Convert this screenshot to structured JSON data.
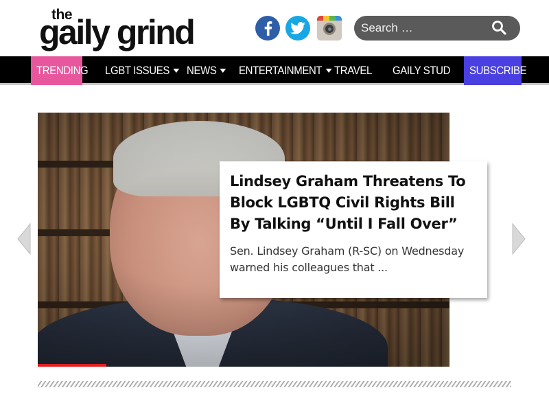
{
  "site": {
    "logo_top": "the",
    "logo_main": "gaily grind"
  },
  "social": [
    {
      "name": "facebook",
      "icon": "facebook-icon",
      "color": "#2f5ea8"
    },
    {
      "name": "twitter",
      "icon": "twitter-icon",
      "color": "#16a7e4"
    },
    {
      "name": "instagram",
      "icon": "instagram-icon",
      "color": "#cfc9bf"
    }
  ],
  "search": {
    "placeholder": "Search …",
    "icon": "search-icon"
  },
  "nav": {
    "items": [
      {
        "label": "TRENDING",
        "dropdown": false
      },
      {
        "label": "LGBT ISSUES",
        "dropdown": true
      },
      {
        "label": "NEWS",
        "dropdown": true
      },
      {
        "label": "ENTERTAINMENT",
        "dropdown": true
      },
      {
        "label": "TRAVEL",
        "dropdown": false
      },
      {
        "label": "GAILY STUD",
        "dropdown": false
      },
      {
        "label": "SUBSCRIBE",
        "dropdown": false
      }
    ],
    "trending_color": "#e8579e",
    "subscribe_color": "#4a3fe0"
  },
  "slider": {
    "title": "Lindsey Graham Threatens To Block LGBTQ Civil Rights Bill By Talking “Until I Fall Over”",
    "excerpt": "Sen. Lindsey Graham (R-SC) on Wednesday warned his colleagues that ...",
    "prev_icon": "chevron-left-icon",
    "next_icon": "chevron-right-icon"
  }
}
